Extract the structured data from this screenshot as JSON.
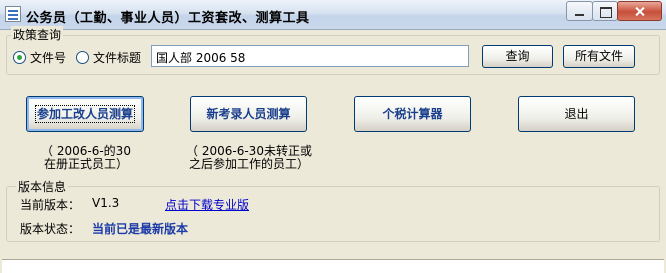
{
  "window": {
    "title": "公务员（工勤、事业人员）工资套改、测算工具"
  },
  "policy_query": {
    "group_label": "政策查询",
    "radio_doc_number": "文件号",
    "radio_doc_title": "文件标题",
    "selected": "文件号",
    "input_value": "国人部 2006 58",
    "query_button": "查询",
    "all_files_button": "所有文件"
  },
  "actions": {
    "reform_calc": "参加工改人员测算",
    "new_hire_calc": "新考录人员测算",
    "tax_calc": "个税计算器",
    "exit": "退出"
  },
  "notes": {
    "reform_line1": "（ 2006-6-的30",
    "reform_line2": "在册正式员工）",
    "new_hire_line1": "（ 2006-6-30未转正或",
    "new_hire_line2": "之后参加工作的员工）"
  },
  "version_info": {
    "group_label": "版本信息",
    "current_label": "当前版本：",
    "current_value": "V1.3",
    "download_link": "点击下载专业版",
    "status_label": "版本状态：",
    "status_value": "当前已是最新版本"
  },
  "colors": {
    "window_bg": "#ece9d8",
    "accent_text": "#1a3f8c",
    "link": "#0000cc",
    "radio_selected": "#2ca43c"
  }
}
